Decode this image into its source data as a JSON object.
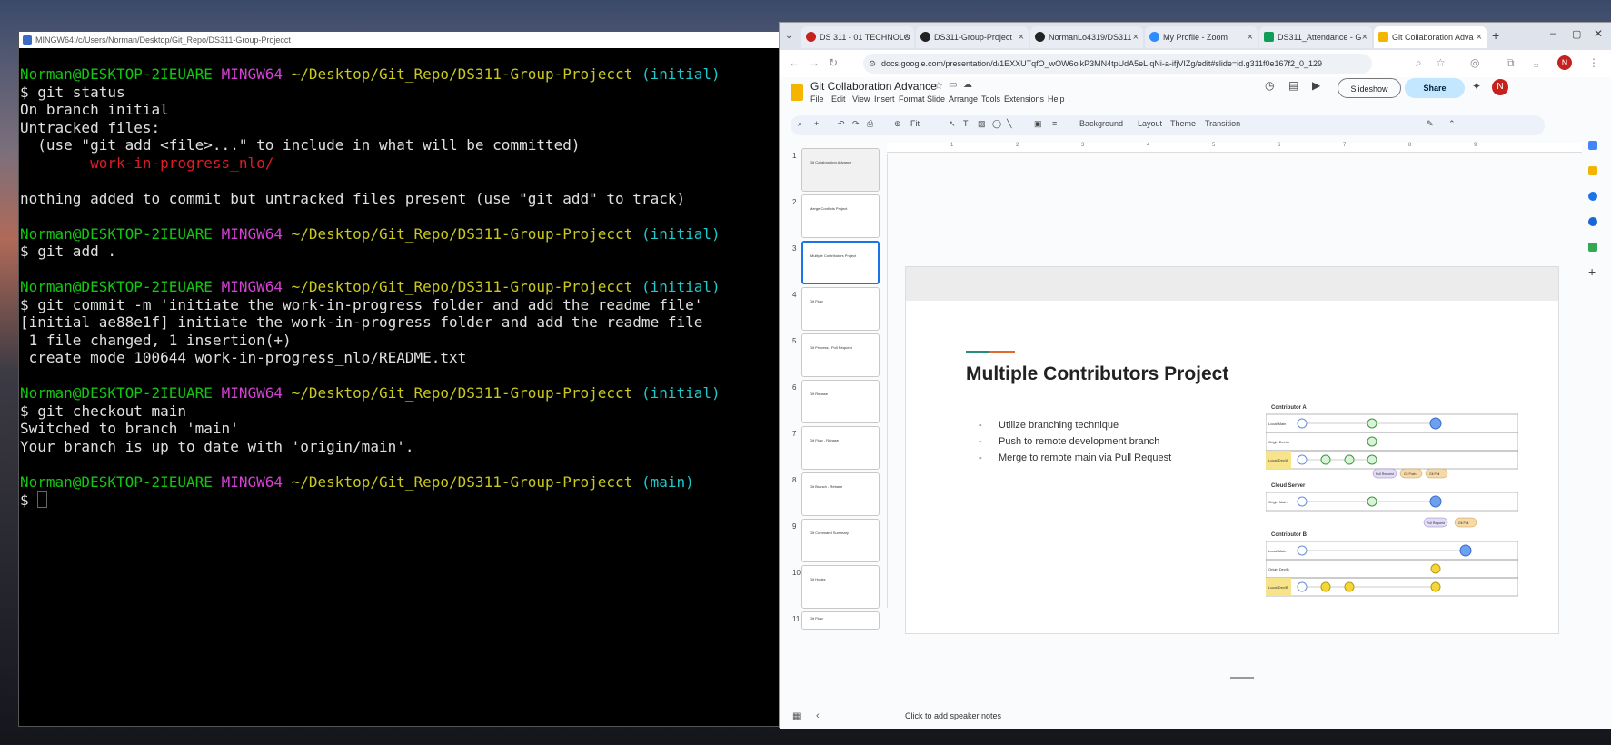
{
  "terminal": {
    "title": "MINGW64:/c/Users/Norman/Desktop/Git_Repo/DS311-Group-Projecct",
    "user_host": "Norman@DESKTOP-2IEUARE",
    "shell": "MINGW64",
    "path": "~/Desktop/Git_Repo/DS311-Group-Projecct",
    "branch_initial": "(initial)",
    "branch_main": "(main)",
    "prompt": "$",
    "cmd1": " git status",
    "out1a": "On branch initial",
    "out1b": "Untracked files:",
    "out1c": "  (use \"git add <file>...\" to include in what will be committed)",
    "out1d": "        work-in-progress_nlo/",
    "out1e": "nothing added to commit but untracked files present (use \"git add\" to track)",
    "cmd2": " git add .",
    "cmd3": " git commit -m 'initiate the work-in-progress folder and add the readme file'",
    "out3a": "[initial ae88e1f] initiate the work-in-progress folder and add the readme file",
    "out3b": " 1 file changed, 1 insertion(+)",
    "out3c": " create mode 100644 work-in-progress_nlo/README.txt",
    "cmd4": " git checkout main",
    "out4a": "Switched to branch 'main'",
    "out4b": "Your branch is up to date with 'origin/main'."
  },
  "browser": {
    "tabs": [
      {
        "label": "DS 311 - 01 TECHNOLO",
        "color": "#c5221f"
      },
      {
        "label": "DS311-Group-Project",
        "color": "#222222"
      },
      {
        "label": "NormanLo4319/DS311",
        "color": "#222222"
      },
      {
        "label": "My Profile - Zoom",
        "color": "#2d8cff"
      },
      {
        "label": "DS311_Attendance - G",
        "color": "#0f9d58"
      },
      {
        "label": "Git Collaboration Adva",
        "color": "#f4b400"
      }
    ],
    "new_tab": "+",
    "url": "docs.google.com/presentation/d/1EXXUTqfO_wOW6olkP3MN4tpUdA5eL qNi-a-ifjVIZg/edit#slide=id.g311f0e167f2_0_129"
  },
  "slides_app": {
    "doc_title": "Git Collaboration Advance",
    "menus": [
      "File",
      "Edit",
      "View",
      "Insert",
      "Format",
      "Slide",
      "Arrange",
      "Tools",
      "Extensions",
      "Help"
    ],
    "slideshow_label": "Slideshow",
    "share_label": "Share",
    "avatar_letter": "N",
    "toolbar": {
      "zoom": "Fit",
      "background": "Background",
      "layout": "Layout",
      "theme": "Theme",
      "transition": "Transition"
    },
    "slide_numbers": [
      "1",
      "2",
      "3",
      "4",
      "5",
      "6",
      "7",
      "8",
      "9",
      "10",
      "11"
    ],
    "thumb_titles": [
      "Git Collaboration Advance",
      "Merge Conflicts Project",
      "Multiple Contributors Project",
      "Git Flow",
      "Git Process / Pull Request",
      "Git Rebase",
      "Git Flow - Rebase",
      "Git Branch - Rebase",
      "Git Command Summary",
      "Git Hooks",
      "Git Flow"
    ],
    "ruler_ticks": [
      "1",
      "2",
      "3",
      "4",
      "5",
      "6",
      "7",
      "8",
      "9"
    ],
    "slide": {
      "title": "Multiple Contributors Project",
      "bullets": [
        "Utilize branching technique",
        "Push  to remote development branch",
        "Merge to remote main via Pull Request"
      ],
      "diagram": {
        "contributor_a": "Contributor A",
        "cloud_server": "Cloud Server",
        "contributor_b": "Contributor B",
        "row_local_main": "Local Main",
        "row_origin_dev": "Origin Dev/A",
        "row_local_dev": "Local Dev/A",
        "row_origin_main": "Origin Main",
        "row_origin_dev_b": "Origin Dev/B",
        "row_local_dev_b": "Local Dev/B",
        "pull_request": "Pull Request",
        "git_push": "Git Push",
        "git_pull": "Git Pull"
      }
    },
    "notes_placeholder": "Click to add speaker notes"
  }
}
